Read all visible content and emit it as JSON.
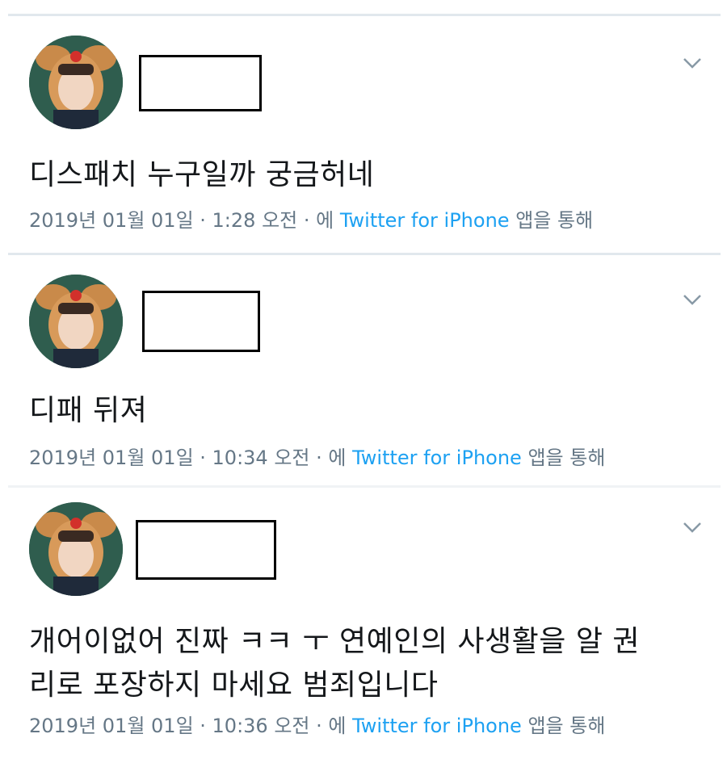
{
  "colors": {
    "link": "#1da1f2",
    "meta_text": "#657786",
    "body_text": "#14171a",
    "divider": "#e1e8ed"
  },
  "tweets": [
    {
      "text": "디스패치 누구일까 궁금허네",
      "date": "2019년 01월 01일 · 1:28 오전 · 에",
      "source": "Twitter for iPhone",
      "source_suffix": "앱을 통해",
      "avatar_icon": "profile-avatar-image",
      "menu_icon": "chevron-down-icon"
    },
    {
      "text": "디패 뒤져",
      "date": "2019년 01월 01일 · 10:34 오전 · 에",
      "source": "Twitter for iPhone",
      "source_suffix": "앱을 통해",
      "avatar_icon": "profile-avatar-image",
      "menu_icon": "chevron-down-icon"
    },
    {
      "text": "개어이없어 진짜 ㅋㅋ ㅜ 연예인의 사생활을 알 권리로 포장하지 마세요 범죄입니다",
      "date": "2019년 01월 01일 · 10:36 오전 · 에",
      "source": "Twitter for iPhone",
      "source_suffix": "앱을 통해",
      "avatar_icon": "profile-avatar-image",
      "menu_icon": "chevron-down-icon"
    }
  ]
}
